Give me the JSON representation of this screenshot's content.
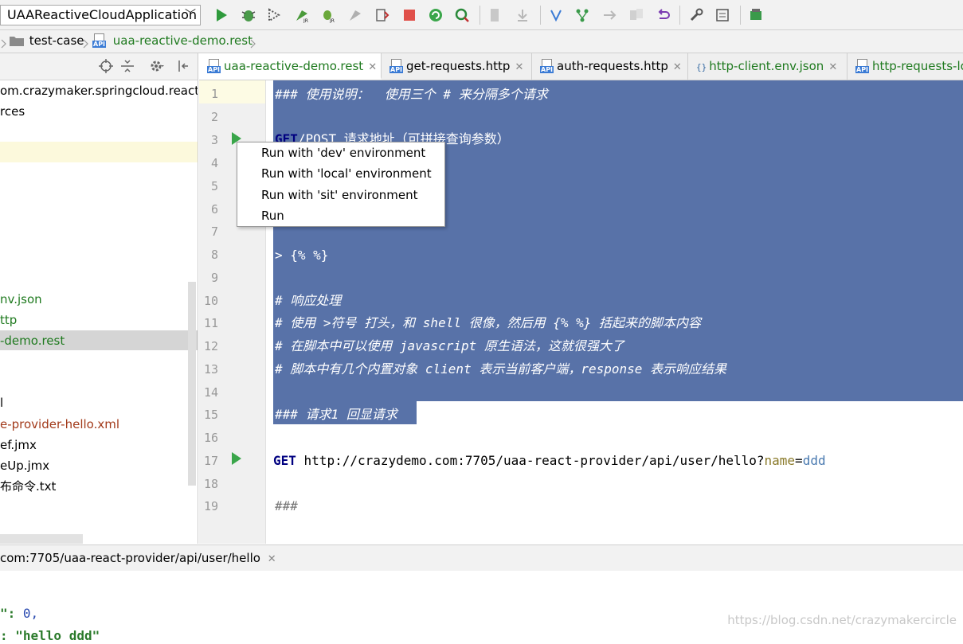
{
  "toolbar": {
    "run_config": "UAAReactiveCloudApplication",
    "icons": [
      "run-icon",
      "debug-icon",
      "coverage-icon",
      "jrebel-run-icon",
      "jrebel-debug-icon",
      "profile-icon",
      "attach-icon",
      "stop-icon",
      "reload-icon",
      "find-icon",
      "vcs-update-icon",
      "vcs-commit-icon",
      "vcs-push-icon",
      "vcs-branch-icon",
      "vcs-merge-icon",
      "vcs-compare-icon",
      "revert-icon",
      "settings-icon",
      "structure-icon",
      "sdk-icon"
    ]
  },
  "navbar": {
    "crumbs": [
      "test-case",
      "uaa-reactive-demo.rest"
    ]
  },
  "project": {
    "rows": [
      {
        "text": "om.crazymaker.springcloud.reactive",
        "color": "normal"
      },
      {
        "text": "rces",
        "color": "normal"
      },
      {
        "text": "nv.json",
        "color": "green"
      },
      {
        "text": "ttp",
        "color": "green"
      },
      {
        "text": "-demo.rest",
        "color": "green"
      },
      {
        "text": "l",
        "color": "normal"
      },
      {
        "text": "e-provider-hello.xml",
        "color": "brown"
      },
      {
        "text": "ef.jmx",
        "color": "normal"
      },
      {
        "text": "eUp.jmx",
        "color": "normal"
      },
      {
        "text": "布命令.txt",
        "color": "normal"
      }
    ]
  },
  "tabs": [
    {
      "label": "uaa-reactive-demo.rest",
      "active": true,
      "icon": "api-file-icon",
      "color": "#1f7a1f"
    },
    {
      "label": "get-requests.http",
      "active": false,
      "icon": "api-file-icon",
      "color": "#000000"
    },
    {
      "label": "auth-requests.http",
      "active": false,
      "icon": "api-file-icon",
      "color": "#000000"
    },
    {
      "label": "http-client.env.json",
      "active": false,
      "icon": "json-file-icon",
      "color": "#1f7a1f"
    },
    {
      "label": "http-requests-lo",
      "active": false,
      "icon": "api-file-icon",
      "color": "#1f7a1f"
    }
  ],
  "editor": {
    "line_numbers": [
      "1",
      "2",
      "3",
      "4",
      "5",
      "6",
      "7",
      "8",
      "9",
      "10",
      "11",
      "12",
      "13",
      "14",
      "15",
      "16",
      "17",
      "18",
      "19"
    ],
    "lines": {
      "l1": "### 使用说明：  使用三个 # 来分隔多个请求",
      "l3_kw": "GET",
      "l3_rest": "/POST 请求地址（可拼接查询参数）",
      "l8": "> {% %}",
      "l10": "# 响应处理",
      "l11": "# 使用 >符号 打头，和 shell 很像，然后用 {% %} 括起来的脚本内容",
      "l12": "# 在脚本中可以使用 javascript 原生语法，这就很强大了",
      "l13": "# 脚本中有几个内置对象 client 表示当前客户端，response 表示响应结果",
      "l15": "### 请求1 回显请求",
      "l17_kw": "GET",
      "l17_url": " http://crazydemo.com:7705/uaa-react-provider/api/user/hello?",
      "l17_param": "name",
      "l17_eq": "=",
      "l17_val": "ddd",
      "l19": "###"
    },
    "colors": {
      "selection": "#5872a8",
      "keyword": "#000080",
      "param_name": "#8a7a2a",
      "param_value": "#4a7ab0",
      "comment": "#ffffff"
    }
  },
  "popup": {
    "items": [
      "Run with 'dev' environment",
      "Run with 'local' environment",
      "Run with 'sit' environment",
      "Run"
    ]
  },
  "bottom": {
    "tab_label": "com:7705/uaa-react-provider/api/user/hello",
    "line1_key": "\": ",
    "line1_val": "0,",
    "line2_text": ": \"hello ddd\""
  },
  "watermark": "https://blog.csdn.net/crazymakercircle"
}
